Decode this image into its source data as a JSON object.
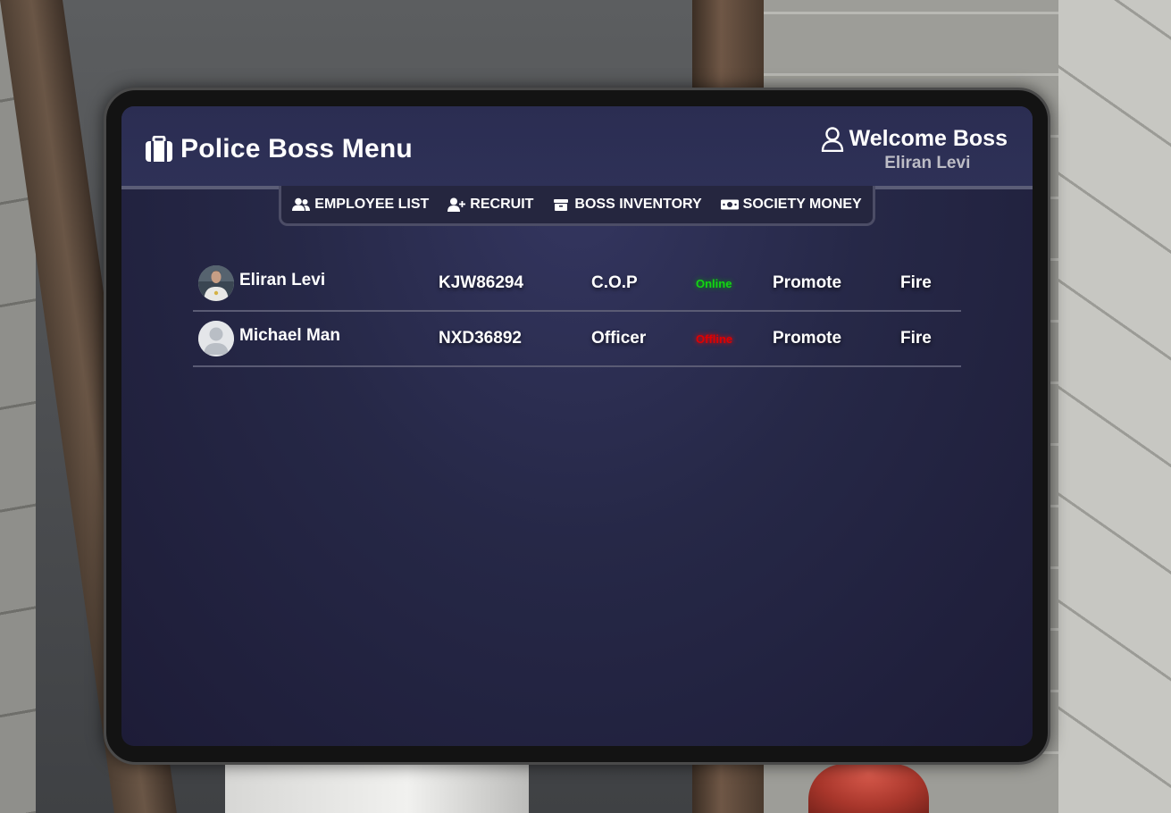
{
  "header": {
    "title": "Police Boss Menu",
    "title_icon": "briefcase-icon",
    "welcome_title": "Welcome Boss",
    "welcome_icon": "user-icon",
    "welcome_name": "Eliran Levi"
  },
  "nav": {
    "items": [
      {
        "label": "EMPLOYEE LIST",
        "icon": "users-icon"
      },
      {
        "label": "RECRUIT",
        "icon": "user-plus-icon"
      },
      {
        "label": "BOSS INVENTORY",
        "icon": "box-icon"
      },
      {
        "label": "SOCIETY MONEY",
        "icon": "money-bill-icon"
      }
    ]
  },
  "employees": [
    {
      "name": "Eliran Levi",
      "id": "KJW86294",
      "rank": "C.O.P",
      "status": "Online",
      "promote_label": "Promote",
      "fire_label": "Fire",
      "avatar": "photo"
    },
    {
      "name": "Michael Man",
      "id": "NXD36892",
      "rank": "Officer",
      "status": "Offline",
      "promote_label": "Promote",
      "fire_label": "Fire",
      "avatar": "default"
    }
  ],
  "colors": {
    "online": "#13d613",
    "offline": "#e00000",
    "panel": "#262847",
    "header": "#2e3157"
  }
}
